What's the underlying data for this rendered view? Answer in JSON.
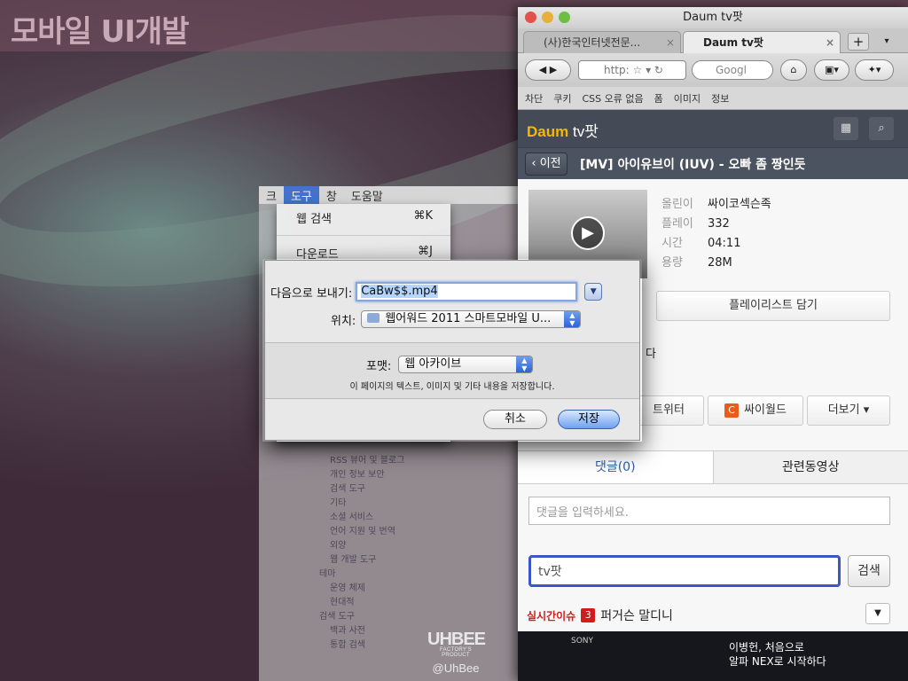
{
  "desktop": {
    "title": "모바일 UI개발",
    "logo_main": "UHBEE",
    "logo_sub": "FACTORY'S PRODUCT",
    "logo_handle": "@UhBee"
  },
  "menubar": {
    "items": [
      "크",
      "도구",
      "창",
      "도움말"
    ],
    "active": "도구"
  },
  "tools_menu": {
    "items": [
      {
        "label": "웹 검색",
        "shortcut": "⌘K"
      },
      {
        "label": "다운로드",
        "shortcut": "⌘J"
      }
    ]
  },
  "prefs_tree": {
    "items": [
      "RSS 뷰어 및 블로그",
      "개인 정보 보안",
      "검색 도구",
      "기타",
      "소셜 서비스",
      "언어 지원 및 번역",
      "외양",
      "웹 개발 도구"
    ],
    "section_theme": "테마",
    "theme_items": [
      "운영 체제",
      "현대적"
    ],
    "section_search": "검색 도구",
    "search_items": [
      "백과 사전",
      "통합 검색"
    ]
  },
  "browser": {
    "window_title": "Daum tv팟",
    "tabs": [
      {
        "label": "(사)한국인터넷전문..."
      },
      {
        "label": "Daum tv팟"
      }
    ],
    "url_text": "http:",
    "search_placeholder": "Googl",
    "bookmarks": [
      "차단",
      "쿠키",
      "CSS 오류 없음",
      "폼",
      "이미지",
      "정보"
    ],
    "daum_logo": "Daum",
    "daum_logo_tv": "tv팟",
    "back_label": "‹ 이전",
    "video_title": "[MV] 아이유브이 (IUV) - 오빠 좀 짱인듯",
    "meta": [
      {
        "key": "올린이",
        "value": "싸이코섹슨족"
      },
      {
        "key": "플레이",
        "value": "332"
      },
      {
        "key": "시간",
        "value": "04:11"
      },
      {
        "key": "용량",
        "value": "28M"
      }
    ],
    "playlist_button": "플레이리스트 담기",
    "partial_text": "다",
    "share": {
      "twitter": "트위터",
      "cyworld": "싸이월드",
      "more": "더보기 ▾"
    },
    "tabs2": [
      "댓글(0)",
      "관련동영상"
    ],
    "comment_placeholder": "댓글을 입력하세요.",
    "search_value": "tv팟",
    "search_button": "검색",
    "issue_label": "실시간이슈",
    "issue_rank": "3",
    "issue_text": "퍼거슨 말디니",
    "banner_line1": "이병헌, 처음으로",
    "banner_line2": "알파 NEX로 시작하다",
    "banner_brand": "SONY"
  },
  "save_dialog": {
    "save_as_label": "다음으로 보내기:",
    "filename": "CaBw$$.mp4",
    "where_label": "위치:",
    "where_value": "웹어워드 2011 스마트모바일 U...",
    "format_label": "포맷:",
    "format_value": "웹 아카이브",
    "description": "이 페이지의 텍스트, 이미지 및 기타 내용을 저장합니다.",
    "cancel": "취소",
    "save": "저장"
  },
  "colors": {
    "accent": "#3a6fd1",
    "daum_header": "#444b57",
    "issue_red": "#d21c1c"
  }
}
